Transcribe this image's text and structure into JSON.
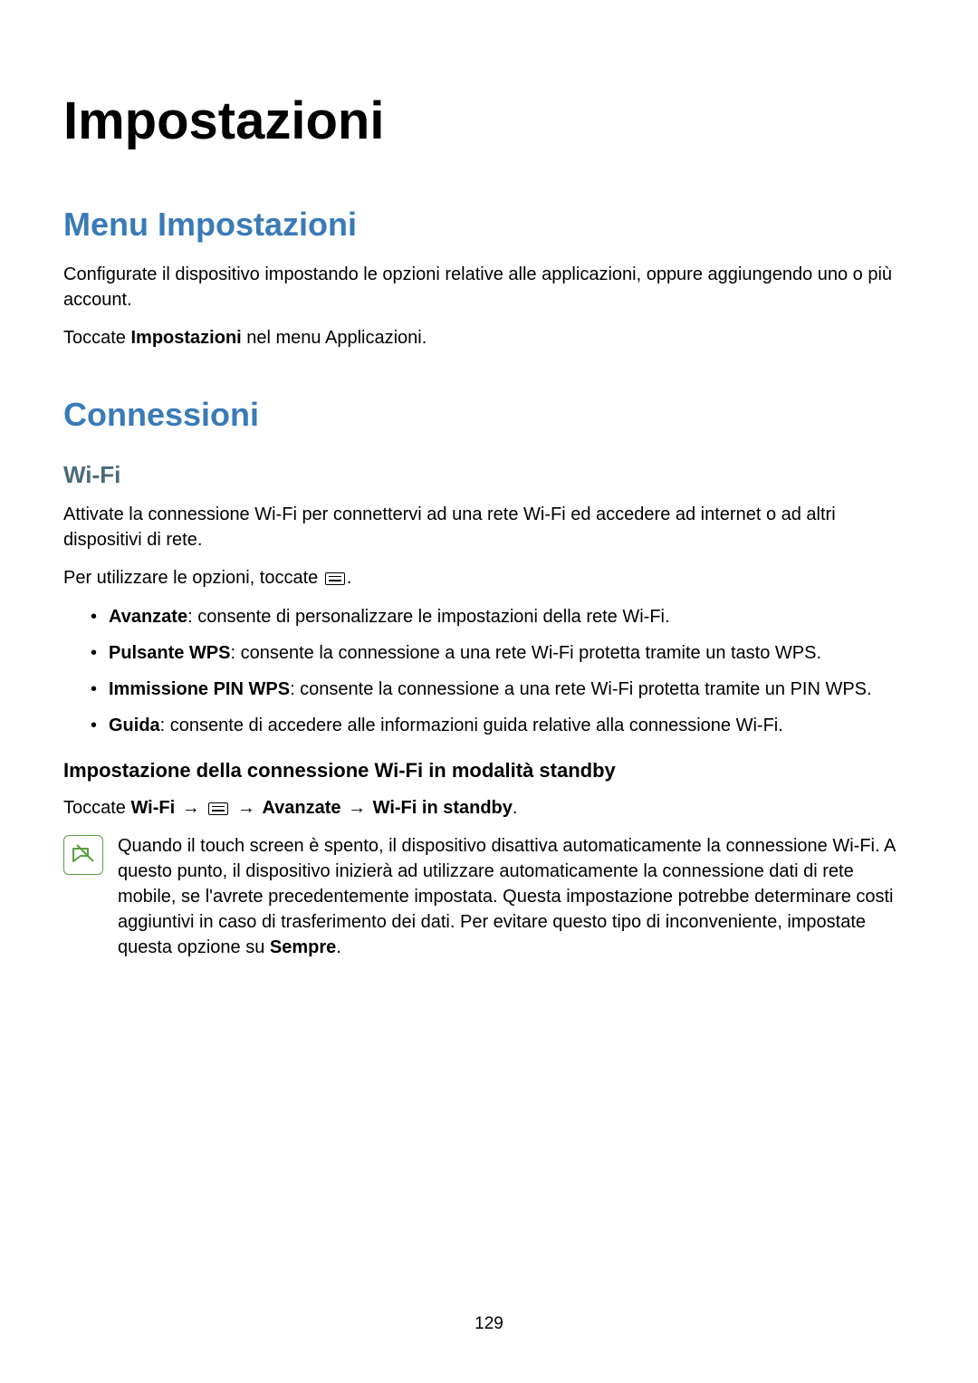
{
  "page": {
    "title": "Impostazioni",
    "number": "129"
  },
  "section1": {
    "heading": "Menu Impostazioni",
    "p1": "Configurate il dispositivo impostando le opzioni relative alle applicazioni, oppure aggiungendo uno o più account.",
    "p2_pre": "Toccate ",
    "p2_bold": "Impostazioni",
    "p2_post": " nel menu Applicazioni."
  },
  "section2": {
    "heading": "Connessioni",
    "sub1": {
      "heading": "Wi-Fi",
      "p1": "Attivate la connessione Wi-Fi per connettervi ad una rete Wi-Fi ed accedere ad internet o ad altri dispositivi di rete.",
      "p2_pre": "Per utilizzare le opzioni, toccate ",
      "p2_post": ".",
      "bullets": [
        {
          "bold": "Avanzate",
          "rest": ": consente di personalizzare le impostazioni della rete Wi-Fi."
        },
        {
          "bold": "Pulsante WPS",
          "rest": ": consente la connessione a una rete Wi-Fi protetta tramite un tasto WPS."
        },
        {
          "bold": "Immissione PIN WPS",
          "rest": ": consente la connessione a una rete Wi-Fi protetta tramite un PIN WPS."
        },
        {
          "bold": "Guida",
          "rest": ": consente di accedere alle informazioni guida relative alla connessione Wi-Fi."
        }
      ],
      "subsub": {
        "heading": "Impostazione della connessione Wi-Fi in modalità standby",
        "path": {
          "pre": "Toccate ",
          "b1": "Wi-Fi",
          "arrow": " → ",
          "b2": "Avanzate",
          "b3": "Wi-Fi in standby",
          "post": "."
        },
        "note_pre": "Quando il touch screen è spento, il dispositivo disattiva automaticamente la connessione Wi-Fi. A questo punto, il dispositivo inizierà ad utilizzare automaticamente la connessione dati di rete mobile, se l'avrete precedentemente impostata. Questa impostazione potrebbe determinare costi aggiuntivi in caso di trasferimento dei dati. Per evitare questo tipo di inconveniente, impostate questa opzione su ",
        "note_bold": "Sempre",
        "note_post": "."
      }
    }
  }
}
